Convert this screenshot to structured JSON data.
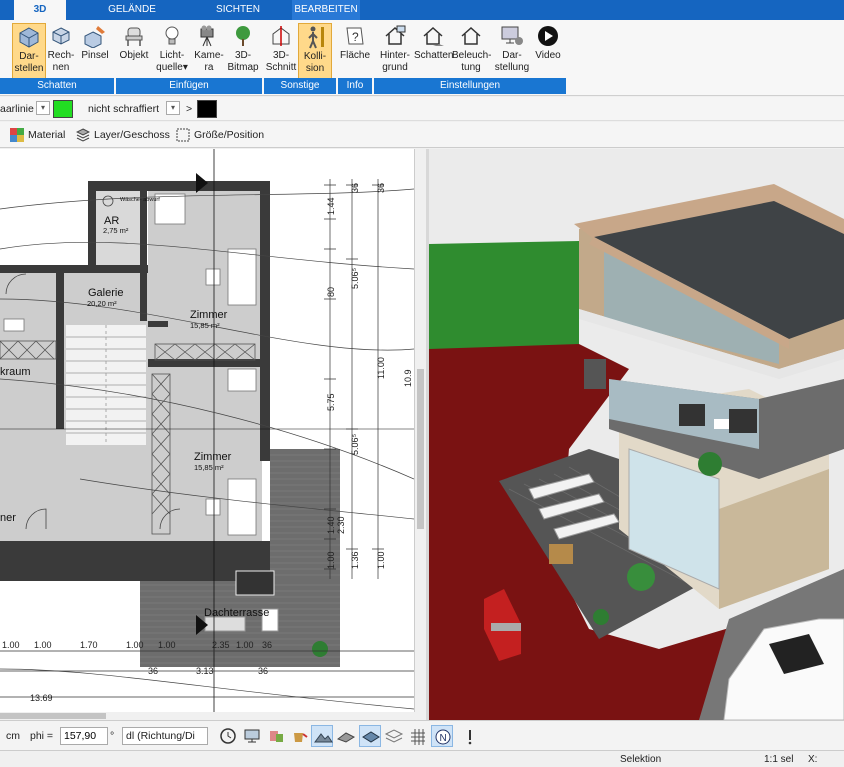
{
  "ribbon_tabs": [
    "3D",
    "GELÄNDE",
    "SICHTEN",
    "BEARBEITEN"
  ],
  "ribbon_buttons": {
    "darstellen": "Dar-\nstellen",
    "rechnen": "Rech-\nnen",
    "pinsel": "Pinsel",
    "objekt": "Objekt",
    "lichtquelle": "Licht-\nquelle▾",
    "kamera": "Kame-\nra",
    "bitmap3d": "3D-\nBitmap",
    "schnitt3d": "3D-\nSchnitt",
    "kollision": "Kolli-\nsion",
    "flaeche": "Fläche",
    "hintergrund": "Hinter-\ngrund",
    "schatten": "Schatten",
    "beleuchtung": "Beleuch-\ntung",
    "darstellung": "Dar-\nstellung",
    "video": "Video"
  },
  "ribbon_groups": [
    "Schatten",
    "Einfügen",
    "Sonstige",
    "Info",
    "Einstellungen"
  ],
  "properties": {
    "line_label": "aarlinie",
    "line_color": "#22dd22",
    "hatch_label": "nicht schraffiert",
    "gt": ">",
    "hatch_color": "#000000"
  },
  "subtoolbar": {
    "material": "Material",
    "layer": "Layer/Geschoss",
    "size": "Größe/Position"
  },
  "plan": {
    "rooms": [
      {
        "name": "AR",
        "area": "2,75 m²"
      },
      {
        "name": "Galerie",
        "area": "20,20 m²"
      },
      {
        "name": "Zimmer",
        "area": "15,85 m²"
      },
      {
        "name": "Zimmer",
        "area": "15,85 m²"
      },
      {
        "name": "kraum",
        "area": ""
      },
      {
        "name": "ner",
        "area": ""
      },
      {
        "name": "Dachterrasse",
        "area": ""
      }
    ],
    "small_label": "Wäsche-\nabwurf",
    "dims_right": [
      "36",
      "1.44",
      "80",
      "5.06⁵",
      "11.00",
      "5.75",
      "5.06⁵",
      "1.40",
      "2.30",
      "1.00",
      "1.36",
      "1.00",
      "36",
      "10.9"
    ],
    "dims_bottom_row1": [
      "1.00",
      "1.00",
      "1.70",
      "1.00",
      "1.00",
      "2.35",
      "1.00",
      "36"
    ],
    "dims_bottom_row2": [
      "36",
      "3.13",
      "36"
    ],
    "dims_total": "13.69"
  },
  "bottom": {
    "unit": "cm",
    "phi_label": "phi =",
    "phi_value": "157,90",
    "degree": "°",
    "mode_value": "dl (Richtung/Di"
  },
  "status": {
    "mode": "Selektion",
    "scale": "1:1 sel",
    "coord": "X:"
  }
}
